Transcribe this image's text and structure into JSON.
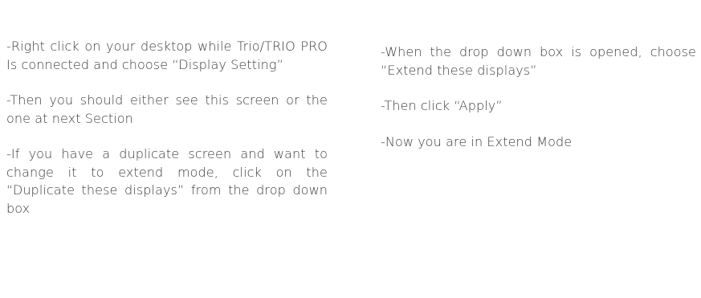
{
  "left_column": {
    "paragraphs": [
      "-Right click on your desktop while Trio/TRIO PRO Is connected and choose “Display Setting”",
      "-Then you should either see this screen or the one at next Section",
      "-If you have a duplicate screen and want to change it to extend mode, click on the “Duplicate these displays” from the drop down box"
    ]
  },
  "right_column": {
    "paragraphs": [
      "-When the drop down box is opened, choose “Extend these displays”",
      "-Then click “Apply”",
      "-Now you are in Extend Mode"
    ]
  }
}
